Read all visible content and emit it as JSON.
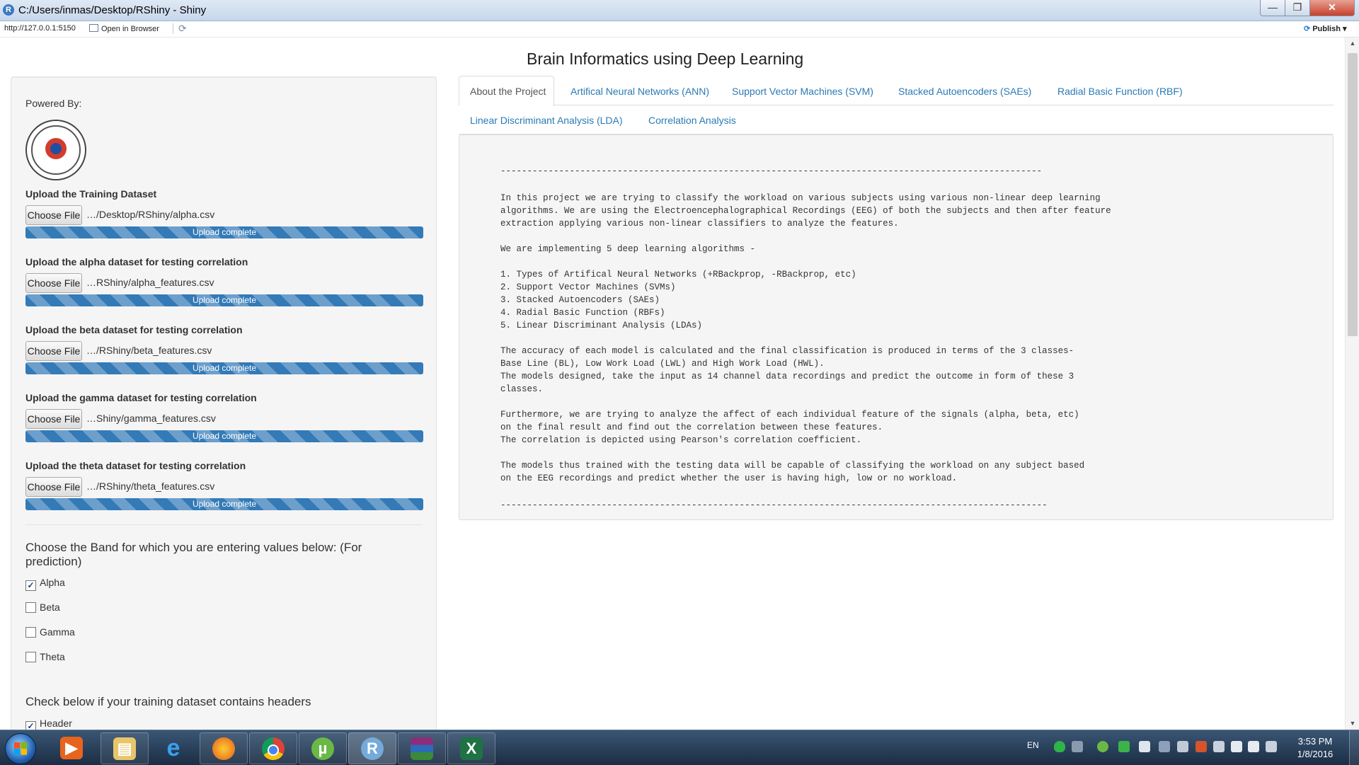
{
  "window": {
    "title": "C:/Users/inmas/Desktop/RShiny - Shiny"
  },
  "toolbar": {
    "url": "http://127.0.0.1:5150",
    "open_in_browser": "Open in Browser",
    "publish": "Publish"
  },
  "page": {
    "title": "Brain Informatics using Deep Learning"
  },
  "sidebar": {
    "powered_by": "Powered By:",
    "uploads": [
      {
        "label": "Upload the Training Dataset",
        "button": "Choose File",
        "file": "…/Desktop/RShiny/alpha.csv",
        "status": "Upload complete"
      },
      {
        "label": "Upload the alpha dataset for testing correlation",
        "button": "Choose File",
        "file": "…RShiny/alpha_features.csv",
        "status": "Upload complete"
      },
      {
        "label": "Upload the beta dataset for testing correlation",
        "button": "Choose File",
        "file": "…/RShiny/beta_features.csv",
        "status": "Upload complete"
      },
      {
        "label": "Upload the gamma dataset for testing correlation",
        "button": "Choose File",
        "file": "…Shiny/gamma_features.csv",
        "status": "Upload complete"
      },
      {
        "label": "Upload the theta dataset for testing correlation",
        "button": "Choose File",
        "file": "…/RShiny/theta_features.csv",
        "status": "Upload complete"
      }
    ],
    "band_label": "Choose the Band for which you are entering values below: (For prediction)",
    "bands": [
      {
        "label": "Alpha",
        "checked": true
      },
      {
        "label": "Beta",
        "checked": false
      },
      {
        "label": "Gamma",
        "checked": false
      },
      {
        "label": "Theta",
        "checked": false
      }
    ],
    "header_label": "Check below if your training dataset contains headers",
    "header_checkbox": {
      "label": "Header",
      "checked": true
    }
  },
  "tabs": [
    {
      "label": "About the Project",
      "active": true
    },
    {
      "label": "Artifical Neural Networks (ANN)",
      "active": false
    },
    {
      "label": "Support Vector Machines (SVM)",
      "active": false
    },
    {
      "label": "Stacked Autoencoders (SAEs)",
      "active": false
    },
    {
      "label": "Radial Basic Function (RBF)",
      "active": false
    },
    {
      "label": "Linear Discriminant Analysis (LDA)",
      "active": false
    },
    {
      "label": "Correlation Analysis",
      "active": false
    }
  ],
  "about": {
    "rule_top": "------------------------------------------------------------------------------------------------------",
    "lines": [
      "In this project we are trying to classify the workload on various subjects using various non-linear deep learning",
      "algorithms. We are using the Electroencephalographical Recordings (EEG) of both the subjects and then after feature",
      "extraction applying various non-linear classifiers to analyze the features.",
      "",
      "We are implementing 5 deep learning algorithms -",
      "",
      "1. Types of Artifical Neural Networks (+RBackprop, -RBackprop, etc)",
      "2. Support Vector Machines (SVMs)",
      "3. Stacked Autoencoders (SAEs)",
      "4. Radial Basic Function (RBFs)",
      "5. Linear Discriminant Analysis (LDAs)",
      "",
      "The accuracy of each model is calculated and the final classification is produced in terms of the 3 classes-",
      "Base Line (BL), Low Work Load (LWL) and High Work Load (HWL).",
      "The models designed, take the input as 14 channel data recordings and predict the outcome in form of these 3",
      "classes.",
      "",
      "Furthermore, we are trying to analyze the affect of each individual feature of the signals (alpha, beta, etc)",
      "on the final result and find out the correlation between these features.",
      "The correlation is depicted using Pearson's correlation coefficient.",
      "",
      "The models thus trained with the testing data will be capable of classifying the workload on any subject based",
      "on the EEG recordings and predict whether the user is having high, low or no workload."
    ],
    "rule_bottom": "-------------------------------------------------------------------------------------------------------"
  },
  "taskbar": {
    "apps": [
      "windows-media-player-icon",
      "file-explorer-icon",
      "internet-explorer-icon",
      "firefox-icon",
      "chrome-icon",
      "utorrent-icon",
      "rstudio-icon",
      "winrar-icon",
      "excel-icon"
    ],
    "language": "EN",
    "time": "3:53 PM",
    "date": "1/8/2016"
  },
  "colors": {
    "accent": "#337ab7",
    "link": "#2a7ab5"
  }
}
